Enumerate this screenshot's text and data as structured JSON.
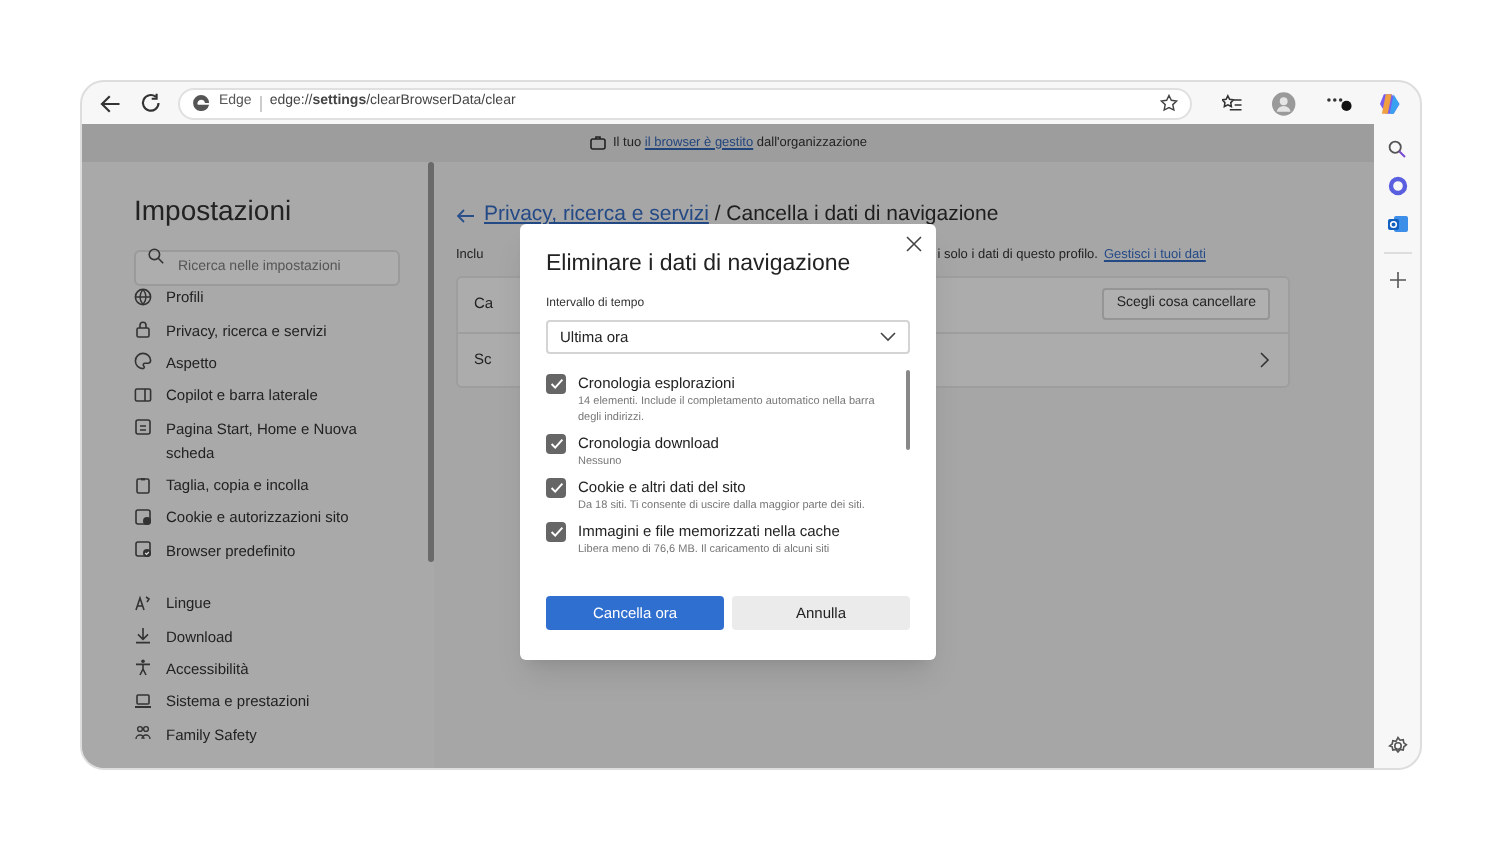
{
  "toolbar": {
    "site_label": "Edge",
    "address": "edge://**settings**/clearBrowserData/clear"
  },
  "info_bar": {
    "before": "Il tuo ",
    "link": "il browser è gestito",
    "after": " dall'organizzazione"
  },
  "sidebar": {
    "title": "Impostazioni",
    "search": {
      "placeholder": "Ricerca nelle impostazioni"
    },
    "items": [
      {
        "label": "Profili"
      },
      {
        "label": "Privacy, ricerca e servizi"
      },
      {
        "label": "Aspetto"
      },
      {
        "label": "Copilot e barra laterale"
      },
      {
        "label": "Pagina Start, Home e Nuova scheda"
      },
      {
        "label": "Taglia, copia e incolla"
      },
      {
        "label": "Cookie e autorizzazioni sito"
      },
      {
        "label": "Browser predefinito"
      },
      {
        "label": "Lingue",
        "group_start": true
      },
      {
        "label": "Download"
      },
      {
        "label": "Accessibilità"
      },
      {
        "label": "Sistema e prestazioni"
      },
      {
        "label": "Family Safety"
      }
    ]
  },
  "page": {
    "breadcrumb_link": "Privacy, ricerca e servizi",
    "breadcrumb_current": " / Cancella i dati di navigazione",
    "intro_start": "Inclu",
    "intro_end": "i solo i dati di questo profilo.",
    "intro_link": "Gestisci i tuoi dati",
    "rows": [
      {
        "label": "Ca",
        "button": "Scegli cosa cancellare"
      },
      {
        "label": "Sc"
      }
    ]
  },
  "dialog": {
    "title": "Eliminare i dati di navigazione",
    "range_label": "Intervallo di tempo",
    "range_value": "Ultima ora",
    "items": [
      {
        "title": "Cronologia esplorazioni",
        "description": "14 elementi. Include il completamento automatico nella barra degli indirizzi.",
        "checked": true
      },
      {
        "title": "Cronologia download",
        "description": "Nessuno",
        "checked": true
      },
      {
        "title": "Cookie e altri dati del sito",
        "description": "Da 18 siti. Ti consente di uscire dalla maggior parte dei siti.",
        "checked": true
      },
      {
        "title": "Immagini e file memorizzati nella cache",
        "description": "Libera meno di 76,6 MB. Il caricamento di alcuni siti",
        "checked": true
      }
    ],
    "primary_button": "Cancella ora",
    "secondary_button": "Annulla"
  }
}
